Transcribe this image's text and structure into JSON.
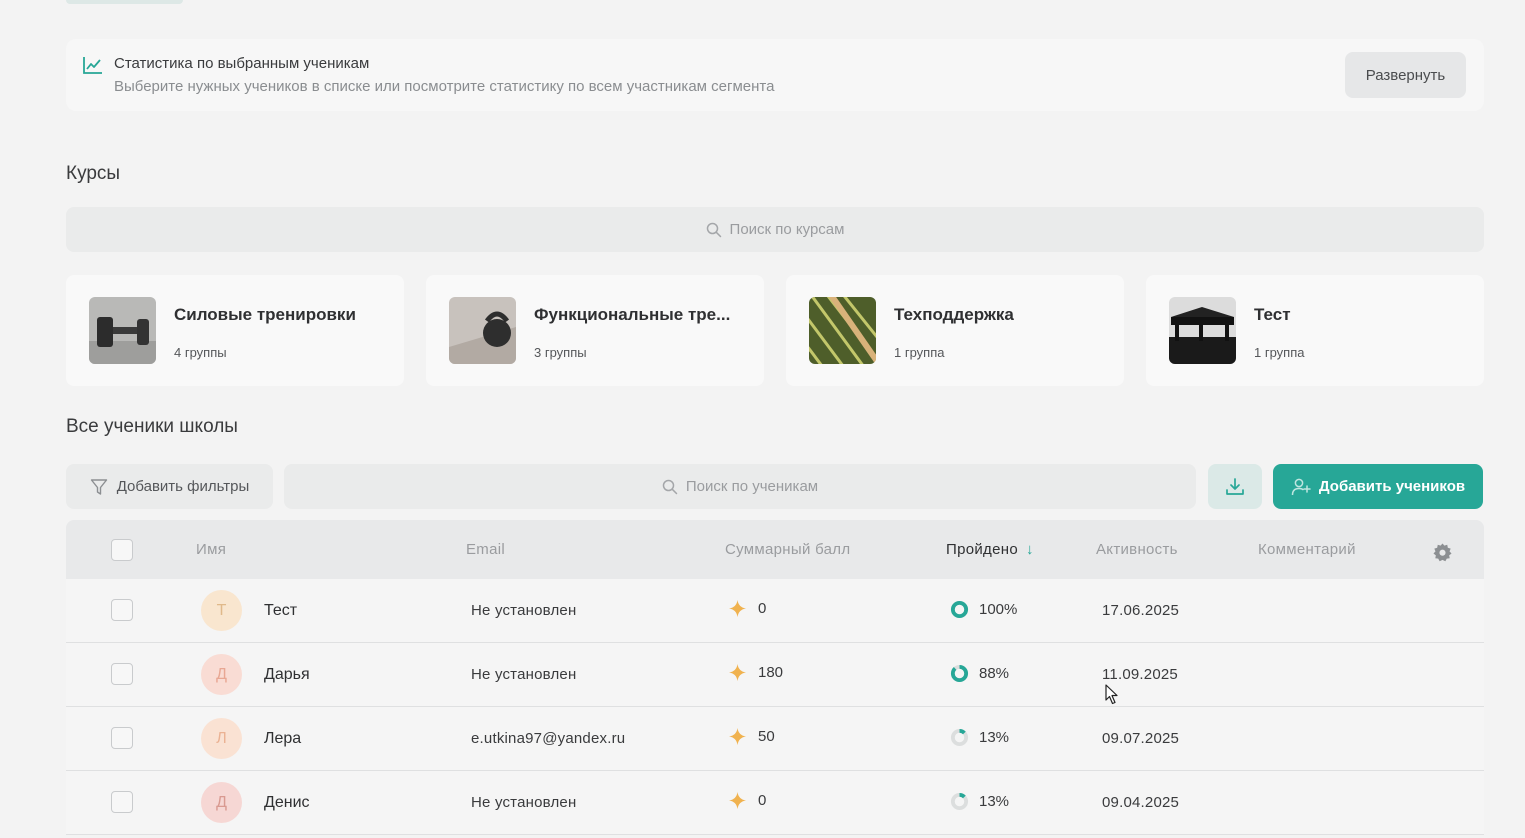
{
  "stats": {
    "icon": "line-chart-icon",
    "title": "Статистика по выбранным ученикам",
    "subtitle": "Выберите нужных учеников в списке или посмотрите статистику по всем участникам сегмента",
    "expand_label": "Развернуть"
  },
  "courses": {
    "heading": "Курсы",
    "search_placeholder": "Поиск по курсам",
    "items": [
      {
        "name": "Силовые тренировки",
        "groups": "4 группы",
        "thumb": "dumbbell-photo"
      },
      {
        "name": "Функциональные тре...",
        "groups": "3 группы",
        "thumb": "kettlebell-photo"
      },
      {
        "name": "Техподдержка",
        "groups": "1 группа",
        "thumb": "field-rows-photo"
      },
      {
        "name": "Тест",
        "groups": "1 группа",
        "thumb": "pavilion-silhouette-photo"
      }
    ]
  },
  "students": {
    "heading": "Все ученики школы",
    "filter_label": "Добавить фильтры",
    "search_placeholder": "Поиск по ученикам",
    "add_label": "Добавить учеников",
    "columns": {
      "name": "Имя",
      "email": "Email",
      "score": "Суммарный балл",
      "passed": "Пройдено",
      "activity": "Активность",
      "comment": "Комментарий"
    },
    "rows": [
      {
        "initial": "Т",
        "name": "Тест",
        "email": "Не установлен",
        "score": "0",
        "passed": "100%",
        "passed_value": 100,
        "activity": "17.06.2025",
        "avatar_bg": "#f9e6cf",
        "avatar_fg": "#e0b98a"
      },
      {
        "initial": "Д",
        "name": "Дарья",
        "email": "Не установлен",
        "score": "180",
        "passed": "88%",
        "passed_value": 88,
        "activity": "11.09.2025",
        "avatar_bg": "#f9dcd4",
        "avatar_fg": "#e8a793"
      },
      {
        "initial": "Л",
        "name": "Лера",
        "email": "e.utkina97@yandex.ru",
        "score": "50",
        "passed": "13%",
        "passed_value": 13,
        "activity": "09.07.2025",
        "avatar_bg": "#fae2d3",
        "avatar_fg": "#ebb293"
      },
      {
        "initial": "Д",
        "name": "Денис",
        "email": "Не установлен",
        "score": "0",
        "passed": "13%",
        "passed_value": 13,
        "activity": "09.04.2025",
        "avatar_bg": "#f6d7d4",
        "avatar_fg": "#d99a91"
      }
    ]
  },
  "colors": {
    "accent": "#27a797",
    "star": "#f0b24f"
  }
}
